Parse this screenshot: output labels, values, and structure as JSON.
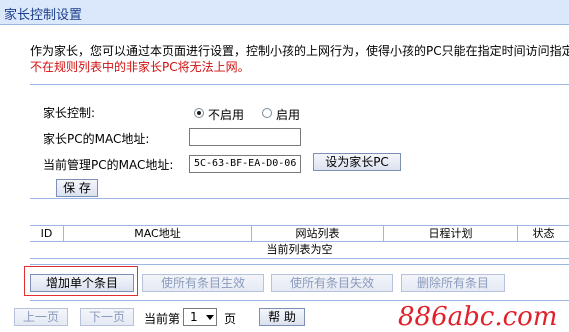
{
  "header": {
    "title": "家长控制设置"
  },
  "description": {
    "line1": "作为家长，您可以通过本页面进行设置，控制小孩的上网行为，使得小孩的PC只能在指定时间访问指定",
    "line2": "不在规则列表中的非家长PC将无法上网。"
  },
  "form": {
    "parental_control_label": "家长控制:",
    "option_disable": "不启用",
    "option_enable": "启用",
    "selected": "disable",
    "parent_mac_label": "家长PC的MAC地址:",
    "parent_mac_value": "",
    "current_mac_label": "当前管理PC的MAC地址:",
    "current_mac_value": "5C-63-BF-EA-D0-06",
    "set_parent_button": "设为家长PC",
    "save_button": "保 存"
  },
  "table": {
    "columns": [
      "ID",
      "MAC地址",
      "网站列表",
      "日程计划",
      "状态"
    ],
    "empty_message": "当前列表为空"
  },
  "actions": {
    "add": "增加单个条目",
    "enable_all": "使所有条目生效",
    "disable_all": "使所有条目失效",
    "delete_all": "删除所有条目"
  },
  "pagination": {
    "prev": "上一页",
    "next": "下一页",
    "current_prefix": "当前第",
    "current_page": "1",
    "suffix": "页",
    "help": "帮 助"
  },
  "watermark": "886abc.com",
  "colors": {
    "accent": "#9cb6e4",
    "warning": "#d01010",
    "watermark": "#e0202a"
  }
}
